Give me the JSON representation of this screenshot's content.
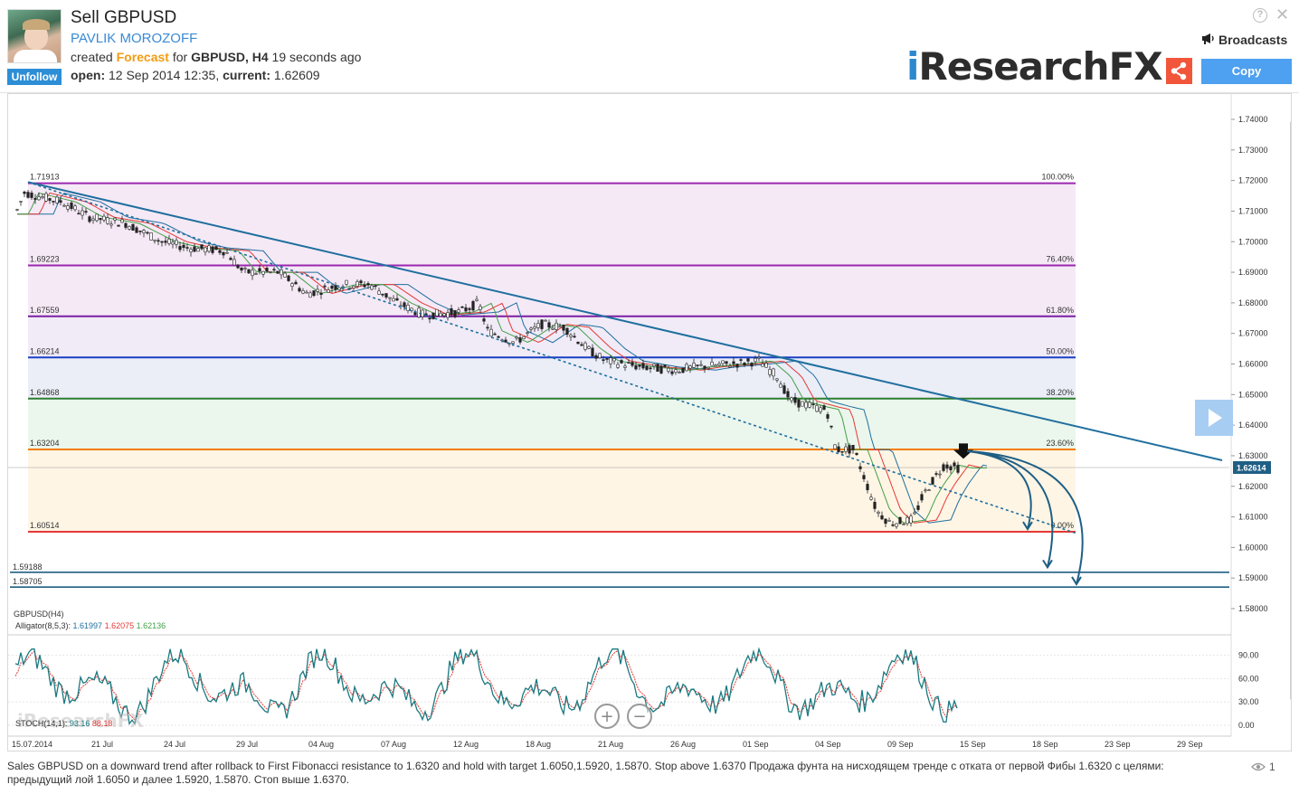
{
  "header": {
    "title": "Sell GBPUSD",
    "author": "PAVLIK MOROZOFF",
    "unfollow_label": "Unfollow",
    "created_prefix": "created ",
    "created_type": "Forecast",
    "created_for": " for ",
    "symbol": "GBPUSD",
    "interval": ", H4",
    "time_ago": " 19 seconds ago",
    "open_label": "open:",
    "open_value": " 12 Sep 2014 12:35, ",
    "current_label": "current:",
    "current_value": " 1.62609",
    "help": "?",
    "close": "✕",
    "broadcasts_label": "Broadcasts",
    "logo_i": "i",
    "logo_rest": "ResearchFX",
    "copy_label": "Copy"
  },
  "chart": {
    "price_axis": [
      "1.74000",
      "1.73000",
      "1.72000",
      "1.71000",
      "1.70000",
      "1.69000",
      "1.68000",
      "1.67000",
      "1.66000",
      "1.65000",
      "1.64000",
      "1.63000",
      "1.62000",
      "1.61000",
      "1.60000",
      "1.59000",
      "1.58000"
    ],
    "current_price_tag": "1.62614",
    "date_axis": [
      "15.07.2014",
      "21 Jul",
      "24 Jul",
      "29 Jul",
      "04 Aug",
      "07 Aug",
      "12 Aug",
      "18 Aug",
      "21 Aug",
      "26 Aug",
      "01 Sep",
      "04 Sep",
      "09 Sep",
      "15 Sep",
      "18 Sep",
      "23 Sep",
      "29 Sep"
    ],
    "fib_levels": [
      {
        "price": "1.71913",
        "pct": "100.00%",
        "color": "#9c27b0"
      },
      {
        "price": "1.69223",
        "pct": "76.40%",
        "color": "#9c27b0"
      },
      {
        "price": "1.67559",
        "pct": "61.80%",
        "color": "#7b1fa2"
      },
      {
        "price": "1.66214",
        "pct": "50.00%",
        "color": "#1a3fc4"
      },
      {
        "price": "1.64868",
        "pct": "38.20%",
        "color": "#2e7d32"
      },
      {
        "price": "1.63204",
        "pct": "23.60%",
        "color": "#f57c00"
      },
      {
        "price": "1.60514",
        "pct": "0.00%",
        "color": "#e53935"
      }
    ],
    "target_levels": [
      "1.59188",
      "1.58705"
    ],
    "indicator_symbol": "GBPUSD(H4)",
    "alligator_label": "Alligator(8,5,3)",
    "alligator_values": [
      "1.61997",
      "1.62075",
      "1.62136"
    ],
    "alligator_colors": [
      "#1f6f9e",
      "#e53935",
      "#43a047"
    ],
    "stoch_label": "STOCH(14,1)",
    "stoch_values": [
      "93.16",
      "88.18"
    ],
    "stoch_axis": [
      "90.00",
      "60.00",
      "30.00",
      "0.00"
    ],
    "watermark": "iResearchFX"
  },
  "description": "Sales GBPUSD on a downward trend after rollback to First Fibonacci resistance to 1.6320 and hold with target 1.6050,1.5920, 1.5870. Stop above 1.6370 Продажа фунта на нисходящем тренде с отката от первой Фибы 1.6320 с целями: предыдущий лой 1.6050 и далее 1.5920, 1.5870. Стоп выше 1.6370.",
  "views_count": "1"
}
